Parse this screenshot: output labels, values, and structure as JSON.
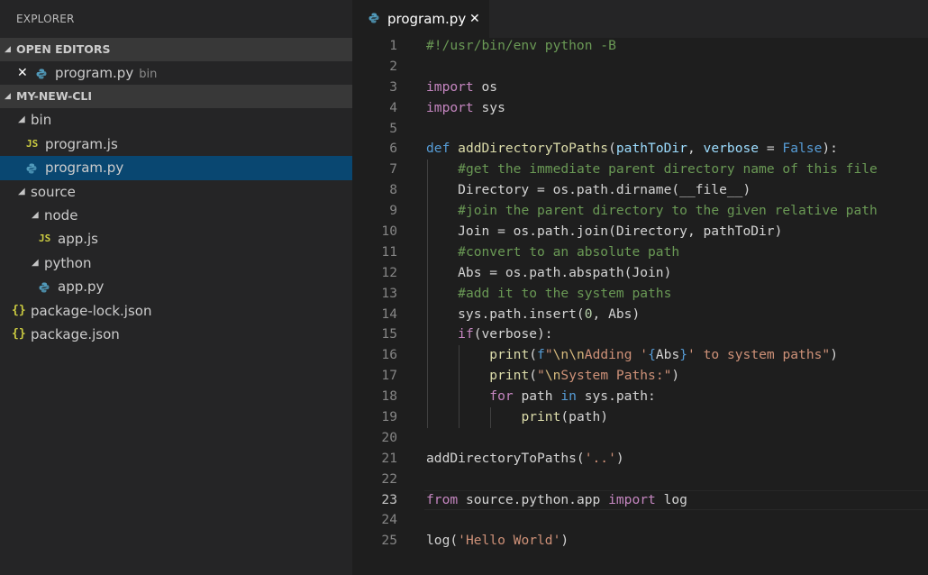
{
  "sidebar": {
    "title": "EXPLORER",
    "open_editors": {
      "header": "OPEN EDITORS",
      "items": [
        {
          "name": "program.py",
          "description": "bin",
          "icon": "python-icon"
        }
      ]
    },
    "project": {
      "header": "MY-NEW-CLI",
      "tree": [
        {
          "label": "bin",
          "type": "folder",
          "depth": 0,
          "expanded": true
        },
        {
          "label": "program.js",
          "type": "js",
          "depth": 1
        },
        {
          "label": "program.py",
          "type": "py",
          "depth": 1,
          "selected": true
        },
        {
          "label": "source",
          "type": "folder",
          "depth": 0,
          "expanded": true
        },
        {
          "label": "node",
          "type": "folder",
          "depth": 1,
          "expanded": true
        },
        {
          "label": "app.js",
          "type": "js",
          "depth": 2
        },
        {
          "label": "python",
          "type": "folder",
          "depth": 1,
          "expanded": true
        },
        {
          "label": "app.py",
          "type": "py",
          "depth": 2
        },
        {
          "label": "package-lock.json",
          "type": "json",
          "depth": 0
        },
        {
          "label": "package.json",
          "type": "json",
          "depth": 0
        }
      ]
    },
    "icons": {
      "js": "JS",
      "json": "{}",
      "close": "✕"
    }
  },
  "editor": {
    "tab": {
      "label": "program.py",
      "close": "✕"
    },
    "current_line": 23,
    "lines": [
      [
        [
          "cmt",
          "#!/usr/bin/env python -B"
        ]
      ],
      [],
      [
        [
          "kw",
          "import"
        ],
        [
          "plain",
          " os"
        ]
      ],
      [
        [
          "kw",
          "import"
        ],
        [
          "plain",
          " sys"
        ]
      ],
      [],
      [
        [
          "kw2",
          "def"
        ],
        [
          "plain",
          " "
        ],
        [
          "fn",
          "addDirectoryToPaths"
        ],
        [
          "plain",
          "("
        ],
        [
          "var",
          "pathToDir"
        ],
        [
          "plain",
          ", "
        ],
        [
          "var",
          "verbose"
        ],
        [
          "plain",
          " = "
        ],
        [
          "kw2",
          "False"
        ],
        [
          "plain",
          "):"
        ]
      ],
      [
        [
          "plain",
          "    "
        ],
        [
          "cmt",
          "#get the immediate parent directory name of this file"
        ]
      ],
      [
        [
          "plain",
          "    Directory = os.path.dirname(__file__)"
        ]
      ],
      [
        [
          "plain",
          "    "
        ],
        [
          "cmt",
          "#join the parent directory to the given relative path"
        ]
      ],
      [
        [
          "plain",
          "    Join = os.path.join(Directory, pathToDir)"
        ]
      ],
      [
        [
          "plain",
          "    "
        ],
        [
          "cmt",
          "#convert to an absolute path"
        ]
      ],
      [
        [
          "plain",
          "    Abs = os.path.abspath(Join)"
        ]
      ],
      [
        [
          "plain",
          "    "
        ],
        [
          "cmt",
          "#add it to the system paths"
        ]
      ],
      [
        [
          "plain",
          "    sys.path.insert("
        ],
        [
          "num",
          "0"
        ],
        [
          "plain",
          ", Abs)"
        ]
      ],
      [
        [
          "plain",
          "    "
        ],
        [
          "kw",
          "if"
        ],
        [
          "plain",
          "(verbose):"
        ]
      ],
      [
        [
          "plain",
          "        "
        ],
        [
          "fn",
          "print"
        ],
        [
          "plain",
          "("
        ],
        [
          "kw2",
          "f"
        ],
        [
          "str",
          "\""
        ],
        [
          "esc",
          "\\n\\n"
        ],
        [
          "str",
          "Adding '"
        ],
        [
          "brace",
          "{"
        ],
        [
          "plain",
          "Abs"
        ],
        [
          "brace",
          "}"
        ],
        [
          "str",
          "' to system paths\""
        ],
        [
          "plain",
          ")"
        ]
      ],
      [
        [
          "plain",
          "        "
        ],
        [
          "fn",
          "print"
        ],
        [
          "plain",
          "("
        ],
        [
          "str",
          "\""
        ],
        [
          "esc",
          "\\n"
        ],
        [
          "str",
          "System Paths:\""
        ],
        [
          "plain",
          ")"
        ]
      ],
      [
        [
          "plain",
          "        "
        ],
        [
          "kw",
          "for"
        ],
        [
          "plain",
          " path "
        ],
        [
          "kw2",
          "in"
        ],
        [
          "plain",
          " sys.path:"
        ]
      ],
      [
        [
          "plain",
          "            "
        ],
        [
          "fn",
          "print"
        ],
        [
          "plain",
          "(path)"
        ]
      ],
      [],
      [
        [
          "plain",
          "addDirectoryToPaths("
        ],
        [
          "str",
          "'..'"
        ],
        [
          "plain",
          ")"
        ]
      ],
      [],
      [
        [
          "kw",
          "from"
        ],
        [
          "plain",
          " source.python.app "
        ],
        [
          "kw",
          "import"
        ],
        [
          "plain",
          " log"
        ]
      ],
      [],
      [
        [
          "plain",
          "log("
        ],
        [
          "str",
          "'Hello World'"
        ],
        [
          "plain",
          ")"
        ]
      ]
    ]
  }
}
